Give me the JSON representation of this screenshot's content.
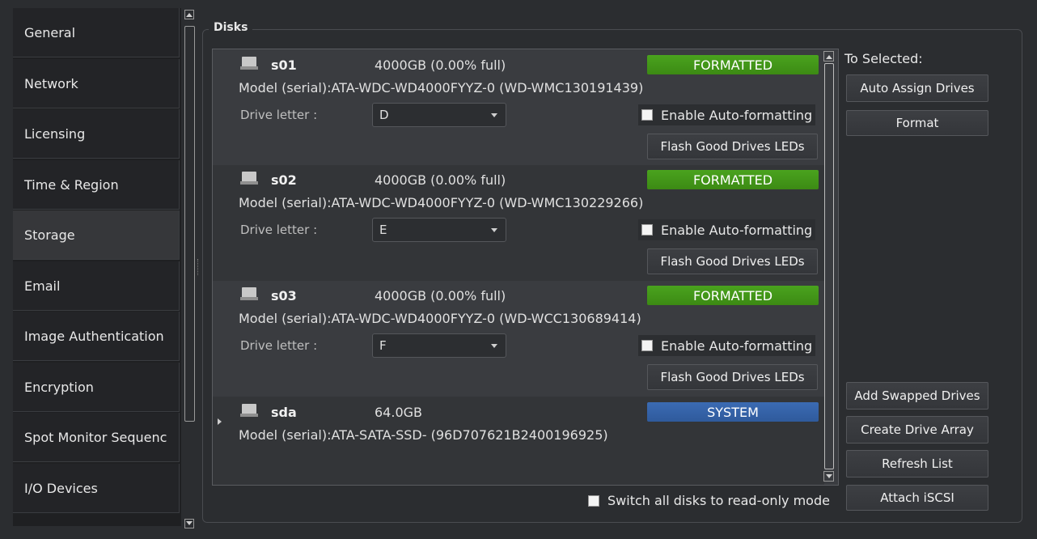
{
  "sidebar": {
    "items": [
      {
        "label": "General"
      },
      {
        "label": "Network"
      },
      {
        "label": "Licensing"
      },
      {
        "label": "Time & Region"
      },
      {
        "label": "Storage"
      },
      {
        "label": "Email"
      },
      {
        "label": "Image Authentication"
      },
      {
        "label": "Encryption"
      },
      {
        "label": "Spot Monitor Sequenc"
      },
      {
        "label": "I/O Devices"
      }
    ],
    "active": "Storage"
  },
  "disks_group": {
    "title": "Disks",
    "drive_letter_label": "Drive letter :",
    "auto_format_label": "Enable Auto-formatting",
    "flash_label": "Flash Good Drives LEDs",
    "disks": [
      {
        "name": "s01",
        "size": "4000GB (0.00% full)",
        "status": "FORMATTED",
        "model": "Model (serial):ATA-WDC-WD4000FYYZ-0 (WD-WMC130191439)",
        "drive_letter": "D"
      },
      {
        "name": "s02",
        "size": "4000GB (0.00% full)",
        "status": "FORMATTED",
        "model": "Model (serial):ATA-WDC-WD4000FYYZ-0 (WD-WMC130229266)",
        "drive_letter": "E"
      },
      {
        "name": "s03",
        "size": "4000GB (0.00% full)",
        "status": "FORMATTED",
        "model": "Model (serial):ATA-WDC-WD4000FYYZ-0 (WD-WCC130689414)",
        "drive_letter": "F"
      },
      {
        "name": "sda",
        "size": "64.0GB",
        "status": "SYSTEM",
        "model": "Model (serial):ATA-SATA-SSD- (96D707621B2400196925)"
      }
    ],
    "status_colors": {
      "formatted": "#42981a",
      "system": "#3563a8"
    },
    "to_selected_label": "To Selected:",
    "buttons": {
      "auto_assign": "Auto Assign Drives",
      "format": "Format",
      "add_swapped": "Add Swapped Drives",
      "create_array": "Create Drive Array",
      "refresh": "Refresh List",
      "attach_iscsi": "Attach iSCSI"
    },
    "readonly_label": "Switch all disks to read-only mode"
  }
}
